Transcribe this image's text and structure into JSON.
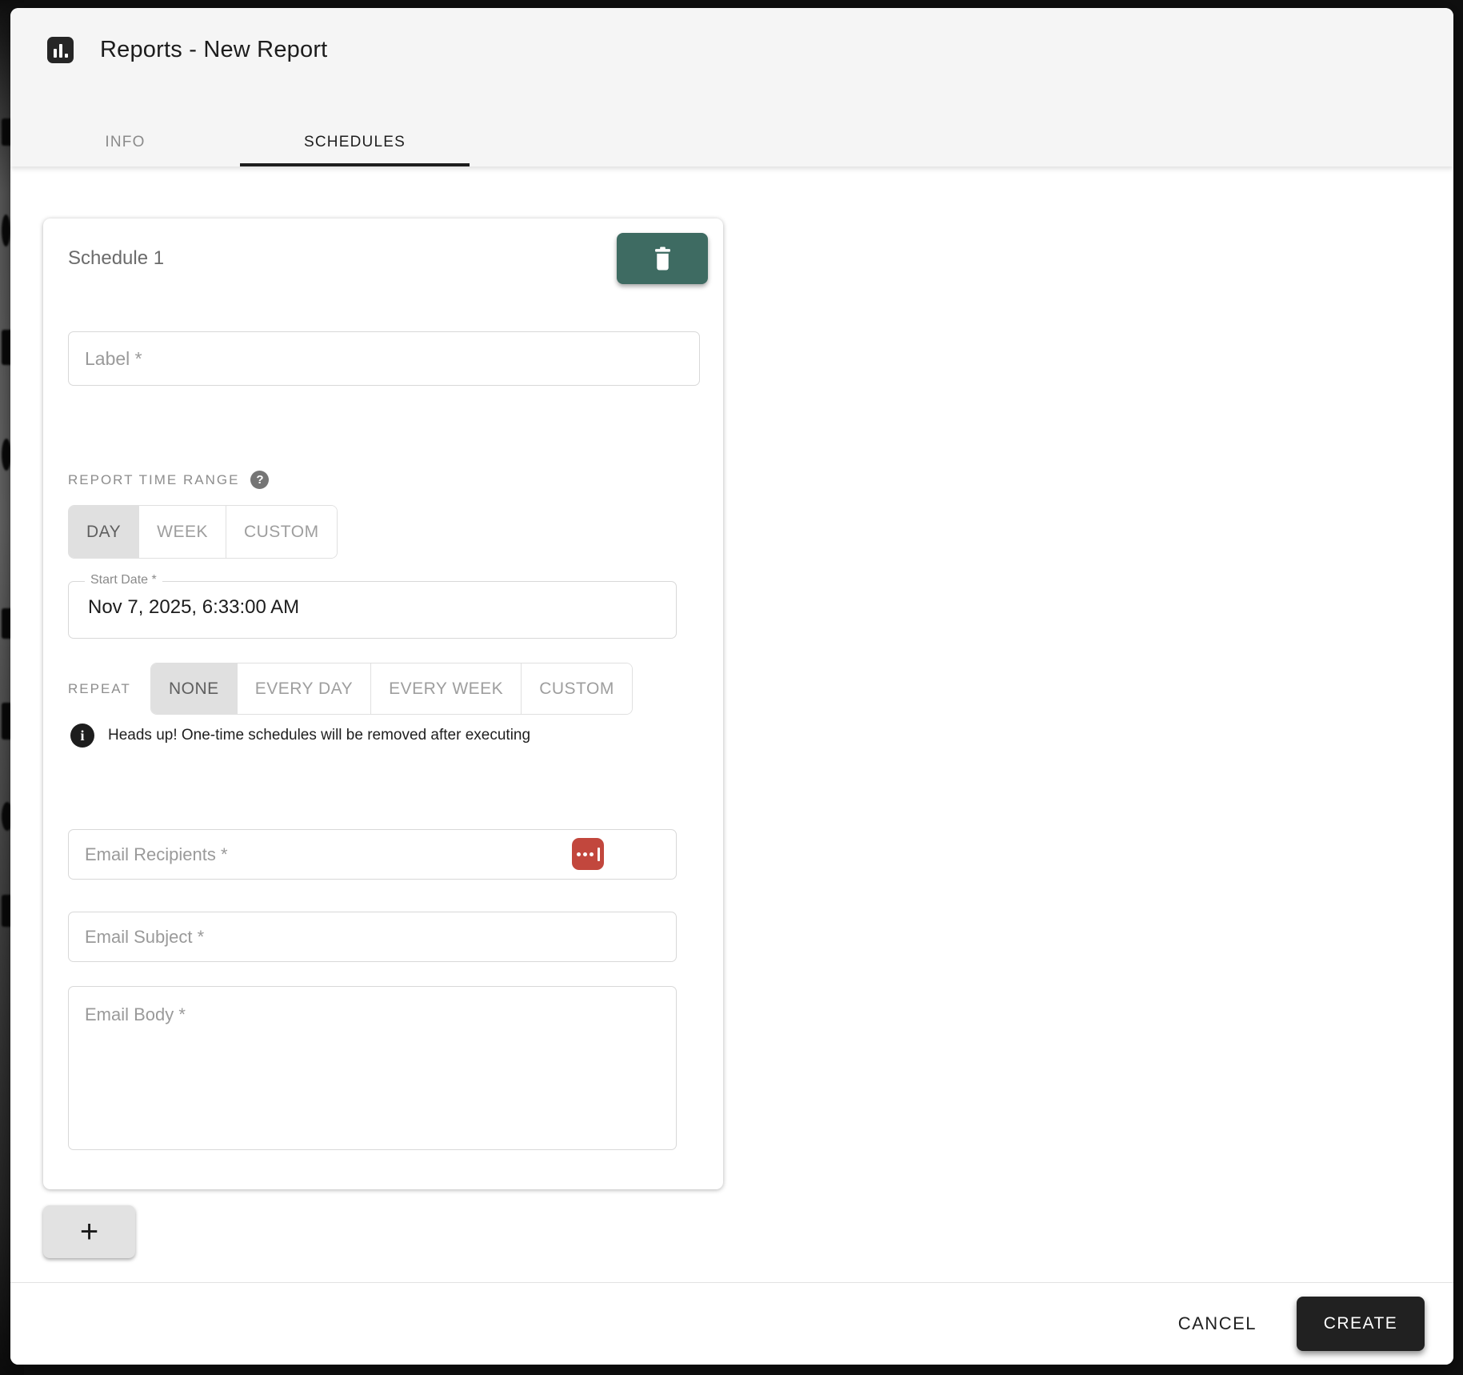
{
  "dialog": {
    "title": "Reports - New Report",
    "tabs": [
      {
        "label": "INFO",
        "active": false
      },
      {
        "label": "SCHEDULES",
        "active": true
      }
    ]
  },
  "schedule_card": {
    "title": "Schedule 1",
    "label_field": {
      "placeholder": "Label *",
      "value": ""
    },
    "report_time_range": {
      "label": "REPORT TIME RANGE",
      "options": [
        "DAY",
        "WEEK",
        "CUSTOM"
      ],
      "selected": "DAY"
    },
    "start_date": {
      "label": "Start Date *",
      "value": "Nov 7, 2025, 6:33:00 AM"
    },
    "repeat": {
      "label": "REPEAT",
      "options": [
        "NONE",
        "EVERY DAY",
        "EVERY WEEK",
        "CUSTOM"
      ],
      "selected": "NONE"
    },
    "notice": "Heads up! One-time schedules will be removed after executing",
    "email_recipients": {
      "placeholder": "Email Recipients *",
      "value": ""
    },
    "email_subject": {
      "placeholder": "Email Subject *",
      "value": ""
    },
    "email_body": {
      "placeholder": "Email Body *",
      "value": ""
    }
  },
  "add_schedule_label": "+",
  "footer": {
    "cancel_label": "CANCEL",
    "create_label": "CREATE"
  },
  "colors": {
    "accent_teal": "#3e6b62",
    "autofill_red": "#c2473d",
    "create_black": "#212121",
    "selected_toggle_gray": "#e0e0e0"
  }
}
